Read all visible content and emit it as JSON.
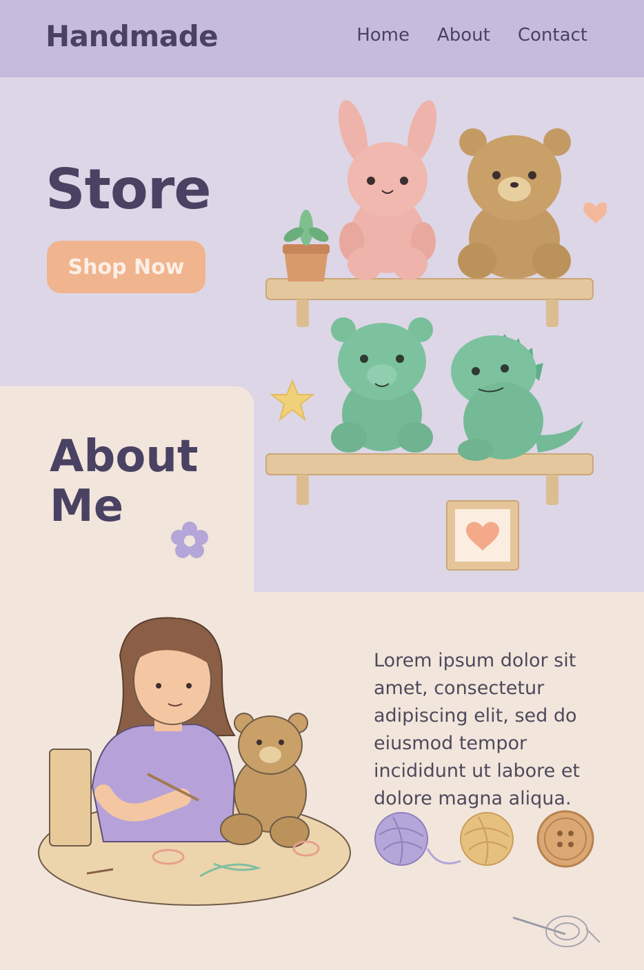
{
  "header": {
    "brand": "Handmade",
    "nav": [
      "Home",
      "About",
      "Contact"
    ]
  },
  "hero": {
    "title": "Store",
    "cta_label": "Shop Now"
  },
  "about": {
    "title": "About Me",
    "paragraph": "Lorem ipsum dolor sit amet, consectetur adipiscing elit, sed do eiusmod tempor incididunt ut labore et dolore magna aliqua."
  },
  "colors": {
    "header_bg": "#c6bbdc",
    "hero_bg": "#ddd6e7",
    "cream_bg": "#f2e6dc",
    "accent_peach": "#f0b48e",
    "text_dark": "#4a4262"
  },
  "icons": [
    "bunny-plush",
    "bear-plush",
    "green-bear-plush",
    "dino-plush",
    "potted-plant-icon",
    "star-icon",
    "heart-icon",
    "flower-icon",
    "yarn-ball-icon",
    "button-icon",
    "needle-thread-icon"
  ]
}
